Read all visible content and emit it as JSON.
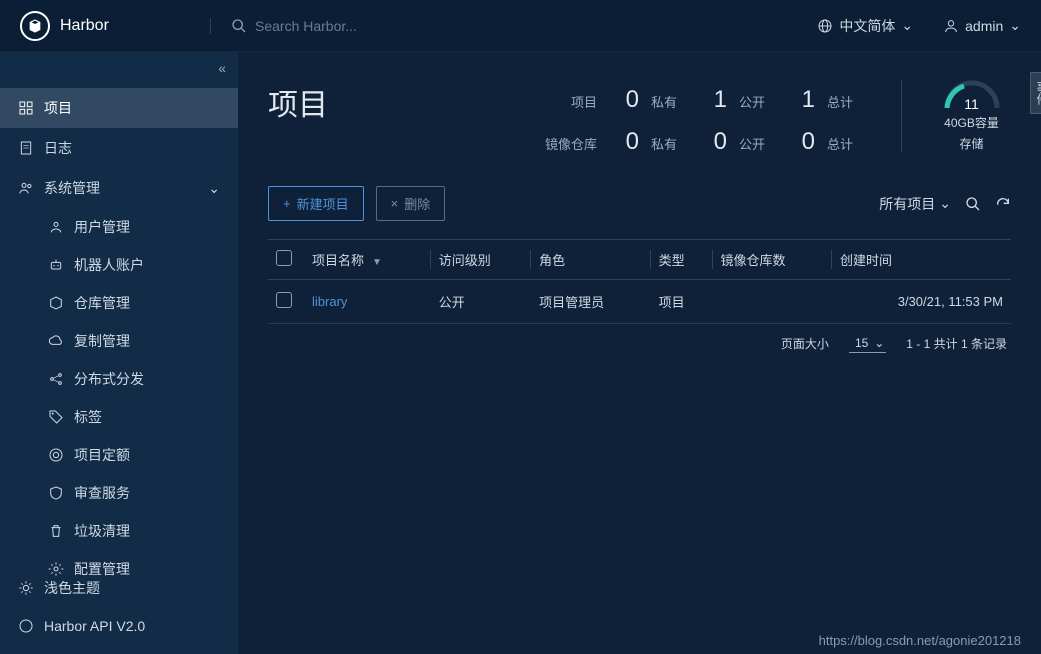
{
  "header": {
    "brand": "Harbor",
    "search_placeholder": "Search Harbor...",
    "language": "中文简体",
    "user": "admin"
  },
  "sidebar": {
    "items": [
      {
        "icon": "grid",
        "label": "项目",
        "active": true
      },
      {
        "icon": "doc",
        "label": "日志"
      },
      {
        "icon": "users",
        "label": "系统管理",
        "expandable": true
      }
    ],
    "subitems": [
      {
        "icon": "user",
        "label": "用户管理"
      },
      {
        "icon": "robot",
        "label": "机器人账户"
      },
      {
        "icon": "cube",
        "label": "仓库管理"
      },
      {
        "icon": "cloud",
        "label": "复制管理"
      },
      {
        "icon": "share",
        "label": "分布式分发"
      },
      {
        "icon": "tag",
        "label": "标签"
      },
      {
        "icon": "target",
        "label": "项目定额"
      },
      {
        "icon": "shield",
        "label": "审查服务"
      },
      {
        "icon": "trash",
        "label": "垃圾清理"
      },
      {
        "icon": "gear",
        "label": "配置管理"
      }
    ],
    "bottom": [
      {
        "icon": "sun",
        "label": "浅色主题"
      },
      {
        "icon": "api",
        "label": "Harbor API V2.0"
      }
    ]
  },
  "page": {
    "title": "项目",
    "stats": {
      "row1": {
        "label": "项目",
        "v1": "0",
        "l1": "私有",
        "v2": "1",
        "l2": "公开",
        "v3": "1",
        "l3": "总计"
      },
      "row2": {
        "label": "镜像仓库",
        "v1": "0",
        "l1": "私有",
        "v2": "0",
        "l2": "公开",
        "v3": "0",
        "l3": "总计"
      }
    },
    "storage": {
      "value": "11",
      "capacity": "40GB容量",
      "label": "存储"
    },
    "toolbar": {
      "new_btn": "新建项目",
      "del_btn": "删除",
      "filter_label": "所有项目"
    },
    "columns": {
      "name": "项目名称",
      "access": "访问级别",
      "role": "角色",
      "type": "类型",
      "repos": "镜像仓库数",
      "created": "创建时间"
    },
    "rows": [
      {
        "name": "library",
        "access": "公开",
        "role": "项目管理员",
        "type": "项目",
        "repos": "",
        "created": "3/30/21, 11:53 PM"
      }
    ],
    "footer": {
      "page_size_label": "页面大小",
      "page_size": "15",
      "summary": "1 - 1 共计 1 条记录"
    }
  },
  "side_tab": "事件",
  "watermark": "https://blog.csdn.net/agonie201218"
}
